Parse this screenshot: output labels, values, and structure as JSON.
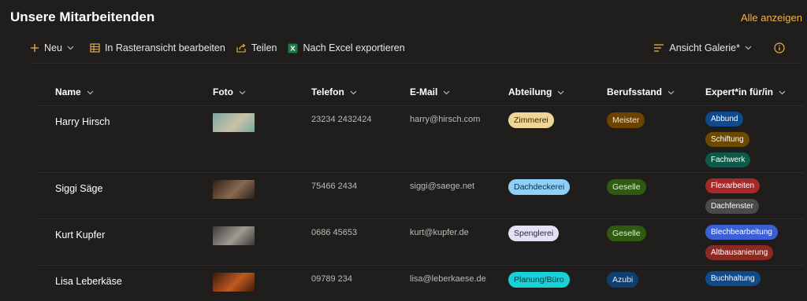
{
  "header": {
    "title": "Unsere Mitarbeitenden",
    "see_all": "Alle anzeigen"
  },
  "toolbar": {
    "new_label": "Neu",
    "grid_edit_label": "In Rasteransicht bearbeiten",
    "share_label": "Teilen",
    "export_label": "Nach Excel exportieren",
    "view_label": "Ansicht Galerie*"
  },
  "columns": [
    "Name",
    "Foto",
    "Telefon",
    "E-Mail",
    "Abteilung",
    "Berufsstand",
    "Expert*in für/in"
  ],
  "rows": [
    {
      "name": "Harry Hirsch",
      "phone": "23234 2432424",
      "email": "harry@hirsch.com",
      "department": {
        "label": "Zimmerei",
        "bg": "#f0d596",
        "fg": "#3a2a05"
      },
      "status": {
        "label": "Meister",
        "bg": "#6b4200",
        "fg": "#f5e6c8"
      },
      "photo_colors": [
        "#7aa6a0",
        "#c9c2a8"
      ],
      "experts": [
        {
          "label": "Abbund",
          "bg": "#0f4a8a"
        },
        {
          "label": "Schiftung",
          "bg": "#6b4a00"
        },
        {
          "label": "Fachwerk",
          "bg": "#0d5a4a"
        }
      ]
    },
    {
      "name": "Siggi Säge",
      "phone": "75466 2434",
      "email": "siggi@saege.net",
      "department": {
        "label": "Dachdeckerei",
        "bg": "#8fd0f8",
        "fg": "#0a2a45"
      },
      "status": {
        "label": "Geselle",
        "bg": "#2f5a10",
        "fg": "#e4f0d4"
      },
      "photo_colors": [
        "#2b1f18",
        "#8a6a50"
      ],
      "experts": [
        {
          "label": "Flexarbeiten",
          "bg": "#a82828"
        },
        {
          "label": "Dachfenster",
          "bg": "#4a4a4a"
        }
      ]
    },
    {
      "name": "Kurt Kupfer",
      "phone": "0686 45653",
      "email": "kurt@kupfer.de",
      "department": {
        "label": "Spenglerei",
        "bg": "#e6e0f4",
        "fg": "#2a2540"
      },
      "status": {
        "label": "Geselle",
        "bg": "#2f5a10",
        "fg": "#e4f0d4"
      },
      "photo_colors": [
        "#3a3a3a",
        "#a09a92"
      ],
      "experts": [
        {
          "label": "Blechbearbeitung",
          "bg": "#3b5fd4"
        },
        {
          "label": "Altbausanierung",
          "bg": "#8a2a22"
        }
      ]
    },
    {
      "name": "Lisa Leberkäse",
      "phone": "09789 234",
      "email": "lisa@leberkaese.de",
      "department": {
        "label": "Planung/Büro",
        "bg": "#18d0d8",
        "fg": "#053538"
      },
      "status": {
        "label": "Azubi",
        "bg": "#0f3f70",
        "fg": "#d8e8f8"
      },
      "photo_colors": [
        "#3a1a0c",
        "#c05a20"
      ],
      "experts": [
        {
          "label": "Buchhaltung",
          "bg": "#0f4a8a"
        }
      ]
    }
  ]
}
